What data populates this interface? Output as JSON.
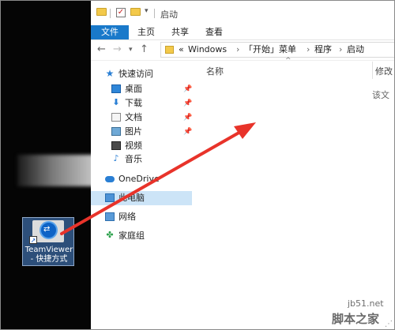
{
  "desktop": {
    "shortcut": {
      "name_line1": "TeamViewer",
      "name_line2": "- 快捷方式",
      "icon": "teamviewer-icon"
    }
  },
  "explorer": {
    "title": "启动",
    "ribbon_tabs": [
      "文件",
      "主页",
      "共享",
      "查看"
    ],
    "breadcrumb": {
      "prefix": "«",
      "items": [
        "Windows",
        "「开始」菜单",
        "程序",
        "启动"
      ]
    },
    "nav": {
      "quick_access": "快速访问",
      "items": [
        {
          "label": "桌面",
          "icon": "desktop-icon",
          "pinned": true
        },
        {
          "label": "下载",
          "icon": "download-icon",
          "pinned": true
        },
        {
          "label": "文档",
          "icon": "documents-icon",
          "pinned": true
        },
        {
          "label": "图片",
          "icon": "pictures-icon",
          "pinned": true
        },
        {
          "label": "视频",
          "icon": "videos-icon",
          "pinned": false
        },
        {
          "label": "音乐",
          "icon": "music-icon",
          "pinned": false
        }
      ],
      "onedrive": "OneDrive",
      "this_pc": "此电脑",
      "network": "网络",
      "homegroup": "家庭组"
    },
    "content": {
      "col_name": "名称",
      "col_modified": "修改",
      "empty_text": "该文"
    }
  },
  "watermark": {
    "url": "jb51.net",
    "name": "脚本之家"
  },
  "colors": {
    "file_tab": "#1979ca",
    "selected_nav": "#cce4f7",
    "arrow": "#e8332a"
  }
}
